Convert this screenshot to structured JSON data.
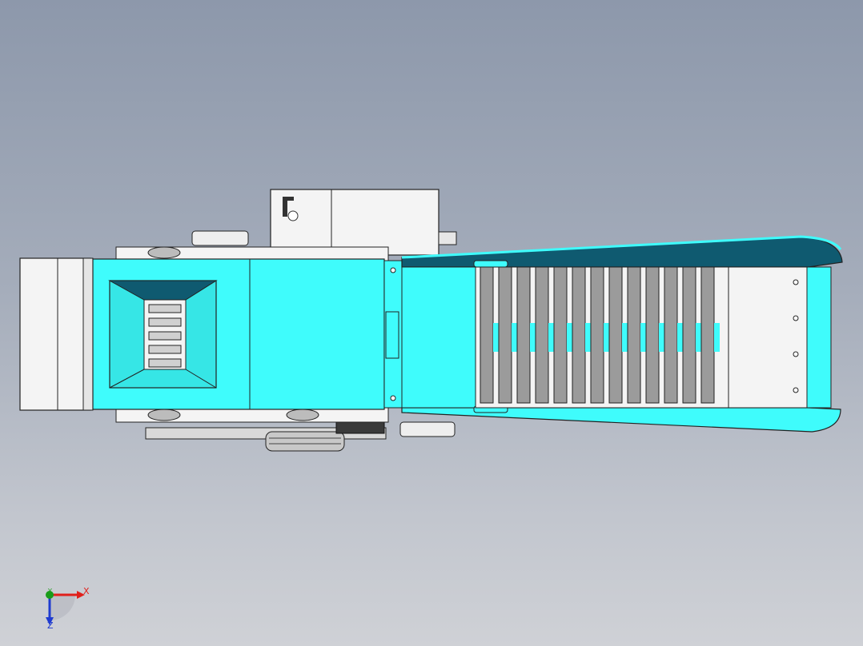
{
  "viewport": {
    "background_top": "#8d98ab",
    "background_bottom": "#cfd1d6"
  },
  "model": {
    "colors": {
      "cyan_main": "#3ffcfc",
      "cyan_dark": "#0f5a70",
      "white_part": "#f4f4f4",
      "grey_slat": "#9b9b9b",
      "outline": "#222222"
    }
  },
  "triad": {
    "x_label": "X",
    "y_label": "Y",
    "z_label": "Z",
    "x_color": "#e0201b",
    "y_color": "#1a9c1a",
    "z_color": "#1f3bd0"
  }
}
